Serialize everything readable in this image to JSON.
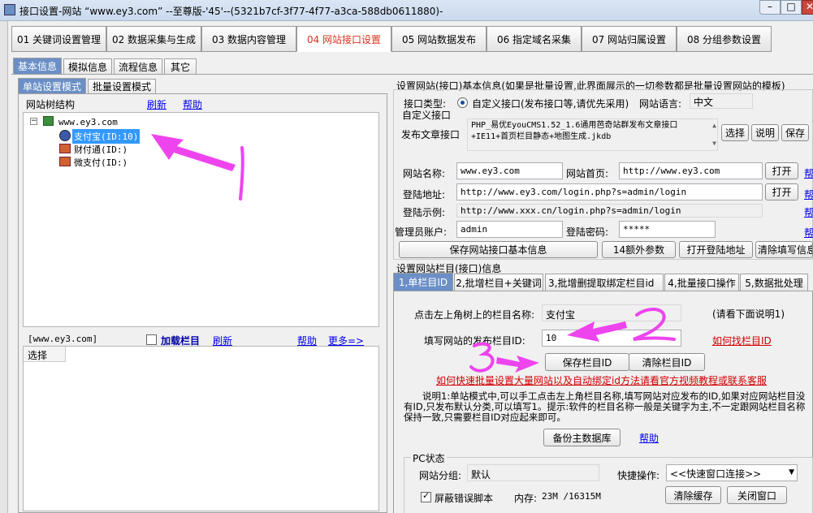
{
  "window": {
    "title": "接口设置-网站 “www.ey3.com” --至尊版-'45'--(5321b7cf-3f77-4f77-a3ca-588db0611880)-"
  },
  "main_tabs": [
    {
      "label": "01 关键词设置管理"
    },
    {
      "label": "02 数据采集与生成"
    },
    {
      "label": "03 数据内容管理"
    },
    {
      "label": "04 网站接口设置",
      "selected": true
    },
    {
      "label": "05 网站数据发布"
    },
    {
      "label": "06 指定域名采集"
    },
    {
      "label": "07 网站归属设置"
    },
    {
      "label": "08 分组参数设置"
    }
  ],
  "sub_tabs": [
    {
      "label": "基本信息",
      "selected": true
    },
    {
      "label": "模拟信息"
    },
    {
      "label": "流程信息"
    },
    {
      "label": "其它"
    }
  ],
  "mode_tabs": [
    {
      "label": "单站设置模式",
      "selected": true
    },
    {
      "label": "批量设置模式"
    }
  ],
  "tree_panel": {
    "title": "网站树结构",
    "refresh": "刷新",
    "help": "帮助",
    "root": "www.ey3.com",
    "children": [
      "支付宝(ID:10)",
      "财付通(ID:)",
      "微支付(ID:)"
    ]
  },
  "lower_panel": {
    "site": "[www.ey3.com]",
    "load_column": "加载栏目",
    "refresh": "刷新",
    "help": "帮助",
    "more": "更多=>",
    "column_header": "选择"
  },
  "right": {
    "section_title": "设置网站(接口)基本信息(如果是批量设置,此界面展示的一切参数都是批量设置网站的模板)",
    "interface_type_label": "接口类型:",
    "interface_type_option": "自定义接口(发布接口等,请优先采用)",
    "language_label": "网站语言:",
    "language_value": "中文",
    "custom_interface_label": "自定义接口",
    "publish_label": "发布文章接口",
    "publish_value_line1": "PHP_易优EyouCMS1.52_1.6通用芭奇站群发布文章接口",
    "publish_value_line2": "+IE11+首页栏目静态+地图生成.jkdb",
    "choose_btn": "选择",
    "explain_btn": "说明",
    "save_btn": "保存",
    "site_name_label": "网站名称:",
    "site_name_value": "www.ey3.com",
    "home_label": "网站首页:",
    "home_value": "http://www.ey3.com",
    "open_btn": "打开",
    "login_label": "登陆地址:",
    "login_value": "http://www.ey3.com/login.php?s=admin/login",
    "example_label": "登陆示例:",
    "example_value": "http://www.xxx.cn/login.php?s=admin/login",
    "admin_label": "管理员账户:",
    "admin_value": "admin",
    "password_label": "登陆密码:",
    "password_value": "*****",
    "help_link": "帮",
    "save_basic_btn": "保存网站接口基本信息",
    "extra_params_btn": "14额外参数",
    "open_login_btn": "打开登陆地址",
    "clear_btn": "清除填写信息"
  },
  "column_section": {
    "title": "设置网站栏目(接口)信息",
    "tabs": [
      {
        "label": "1,单栏目ID",
        "selected": true
      },
      {
        "label": "2,批增栏目+关键词"
      },
      {
        "label": "3,批增删提取绑定栏目id"
      },
      {
        "label": "4,批量接口操作"
      },
      {
        "label": "5,数据批处理"
      }
    ],
    "click_label": "点击左上角树上的栏目名称:",
    "click_value": "支付宝",
    "see_note": "(请看下面说明1)",
    "fill_label": "填写网站的发布栏目ID:",
    "fill_value": "10",
    "how_find": "如何找栏目ID",
    "save_btn": "保存栏目ID",
    "clear_btn": "清除栏目ID",
    "red_link": "如何快速批量设置大量网站以及自动绑定id方法请看官方视频教程或联系客服",
    "note": "说明1:单站模式中,可以手工点击左上角栏目名称,填写网站对应发布的ID,如果对应网站栏目没有ID,只发布默认分类,可以填写1。提示:软件的栏目名称一般是关键字为主,不一定跟网站栏目名称保持一致,只需要栏目ID对应起来即可。",
    "backup_btn": "备份主数据库",
    "help": "帮助"
  },
  "pc_status": {
    "title": "PC状态",
    "group_label": "网站分组:",
    "group_value": "默认",
    "quick_label": "快捷操作:",
    "quick_value": "<<快速窗口连接>>",
    "shield_label": "屏蔽错误脚本",
    "memory_label": "内存:",
    "memory_value": "23M /16315M",
    "clear_cache_btn": "清除缓存",
    "close_btn": "关闭窗口"
  },
  "annotations": [
    "1",
    "2",
    "3"
  ],
  "colors": {
    "accent_blue": "#3399ff",
    "selected_tab_red": "#e0301e",
    "arrow_magenta": "#ee44ee",
    "link_red": "#d00000"
  }
}
